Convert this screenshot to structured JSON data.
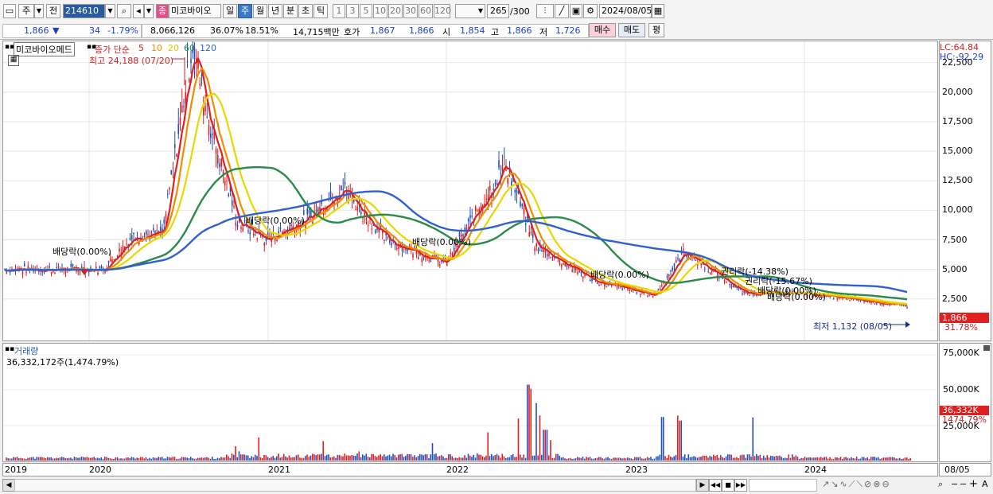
{
  "toolbar": {
    "type_label": "주",
    "prev_label": "전",
    "code": "214610",
    "stock_name": "미코바이오",
    "stock_badge": "종",
    "periods": [
      "일",
      "주",
      "월",
      "년",
      "분",
      "초",
      "틱"
    ],
    "selected_period": "주",
    "intervals": [
      "1",
      "3",
      "5",
      "10",
      "20",
      "30",
      "60",
      "120"
    ],
    "count": "265",
    "count_max": "/300",
    "date": "2024/08/05"
  },
  "quote": {
    "price": "1,866",
    "change_arrow": "▼",
    "change": "34",
    "change_pct": "-1.79%",
    "volume": "8,066,126",
    "volume_pct": "36.07%",
    "turnover": "18.51%",
    "amount": "14,715백만",
    "ask_label": "호가",
    "ask": "1,867",
    "bid": "1,866",
    "open_label": "시",
    "open": "1,854",
    "high_label": "고",
    "high": "1,866",
    "low_label": "저",
    "low": "1,726",
    "buy_label": "매수",
    "sell_label": "매도",
    "eval_label": "평"
  },
  "chart_header": {
    "name": "미코바이오메드",
    "ma_label": "종가 단순",
    "ma_periods": [
      "5",
      "10",
      "20",
      "60",
      "120"
    ],
    "ma_colors": [
      "#e02020",
      "#f08c00",
      "#e8d800",
      "#2a8a4a",
      "#3060d0"
    ],
    "high_note": "최고 24,188 (07/20)",
    "low_note": "최저 1,132 (08/05)",
    "lc": "LC:64.84",
    "hc": "HC:-92.29"
  },
  "annotations": {
    "div_1": "배당락(0.00%)",
    "div_2": "배당락(0.00%)",
    "div_3": "배당락(0.00%)",
    "div_4": "배당락(0.00%)",
    "right_1": "권리락(-14.38%)",
    "right_2": "권리락(-15.67%)",
    "right_3": "배당락(0.00%)",
    "right_4": "배당락(0.00%)"
  },
  "y_axis": [
    "22,500",
    "20,000",
    "17,500",
    "15,000",
    "12,500",
    "10,000",
    "7,500",
    "5,000",
    "2,500"
  ],
  "current_price_tag": "1,866",
  "current_price_pct": "31.78%",
  "volume_panel": {
    "title": "거래량",
    "value": "36,332,172주(1,474.79%)",
    "y_axis": [
      "75,000K",
      "50,000K",
      "25,000K"
    ],
    "tag": "36,332K",
    "tag_pct": "1474.79%"
  },
  "x_axis": [
    "2019",
    "2020",
    "2021",
    "2022",
    "2023",
    "2024"
  ],
  "x_axis_right": "08/05",
  "chart_data": {
    "type": "candlestick",
    "title": "미코바이오메드",
    "x": [
      "2019",
      "2020",
      "2021",
      "2022",
      "2023",
      "2024"
    ],
    "price_key_points": [
      {
        "date": "2019-06",
        "price": 5000
      },
      {
        "date": "2020-01",
        "price": 5000
      },
      {
        "date": "2020-03",
        "price": 7800
      },
      {
        "date": "2020-05",
        "price": 8000
      },
      {
        "date": "2020-07",
        "price": 24188
      },
      {
        "date": "2020-08",
        "price": 18000
      },
      {
        "date": "2020-10",
        "price": 9000
      },
      {
        "date": "2020-12",
        "price": 7500
      },
      {
        "date": "2021-03",
        "price": 9500
      },
      {
        "date": "2021-05",
        "price": 12000
      },
      {
        "date": "2021-08",
        "price": 7500
      },
      {
        "date": "2021-12",
        "price": 5500
      },
      {
        "date": "2022-04",
        "price": 14000
      },
      {
        "date": "2022-06",
        "price": 7000
      },
      {
        "date": "2022-10",
        "price": 4000
      },
      {
        "date": "2023-02",
        "price": 2800
      },
      {
        "date": "2023-04",
        "price": 6500
      },
      {
        "date": "2023-08",
        "price": 3000
      },
      {
        "date": "2023-12",
        "price": 3000
      },
      {
        "date": "2024-08",
        "price": 1866
      }
    ],
    "ylim": [
      0,
      25000
    ]
  }
}
